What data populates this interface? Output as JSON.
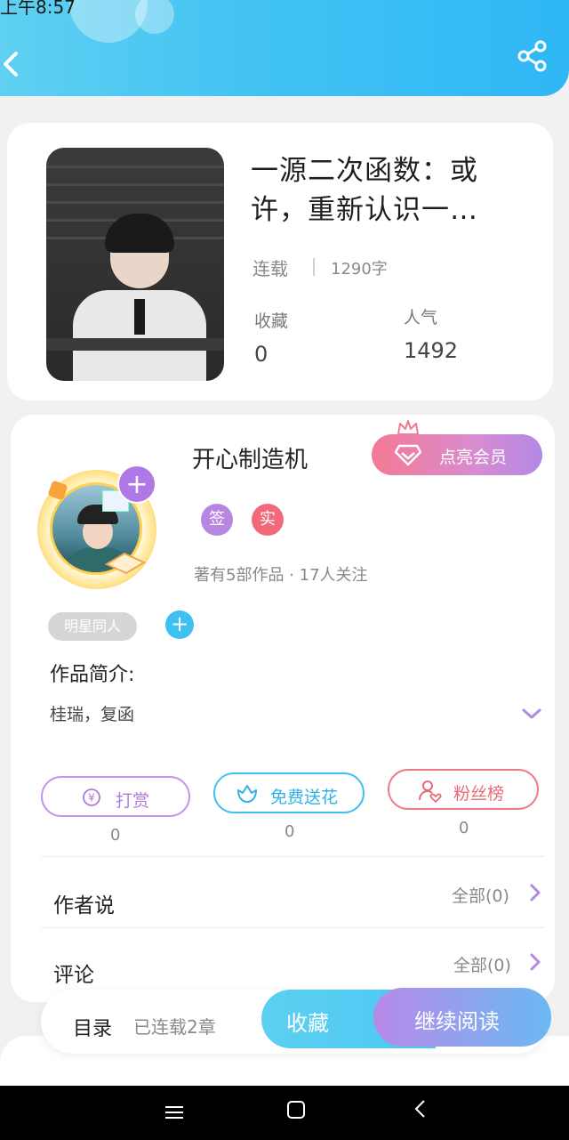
{
  "status_bar": {
    "time": "上午8:57"
  },
  "header": {
    "back_icon": "chevron-left-icon",
    "share_icon": "share-icon",
    "color": "#3fc1f3"
  },
  "book": {
    "title": "一源二次函数：或许，重新认识一…",
    "status": "连载",
    "word_count": "1290字",
    "favorites_label": "收藏",
    "favorites_value": "0",
    "popularity_label": "人气",
    "popularity_value": "1492"
  },
  "author": {
    "name": "开心制造机",
    "vip_button": "点亮会员",
    "badges": [
      {
        "label": "签",
        "color": "#b686e0"
      },
      {
        "label": "实",
        "color": "#f06a7a"
      }
    ],
    "meta": "著有5部作品 · 17人关注"
  },
  "tags": {
    "items": [
      "明星同人"
    ],
    "add_label": "+"
  },
  "intro": {
    "heading": "作品简介:",
    "text": "桂瑞，复函"
  },
  "actions": [
    {
      "label": "打赏",
      "count": "0",
      "color": "#c694ea",
      "icon": "yen-icon"
    },
    {
      "label": "免费送花",
      "count": "0",
      "color": "#3ec1ef",
      "icon": "flower-icon"
    },
    {
      "label": "粉丝榜",
      "count": "0",
      "color": "#ef7a86",
      "icon": "fans-icon"
    }
  ],
  "sections": [
    {
      "title": "作者说",
      "link": "全部(0)"
    },
    {
      "title": "评论",
      "link": "全部(0)"
    }
  ],
  "bottom_bar": {
    "toc_label": "目录",
    "toc_status": "已连载2章",
    "favorite_label": "收藏",
    "read_label": "继续阅读"
  },
  "nav_bar": {
    "menu_icon": "menu-icon",
    "home_icon": "home-square-icon",
    "back_icon": "back-triangle-icon"
  }
}
